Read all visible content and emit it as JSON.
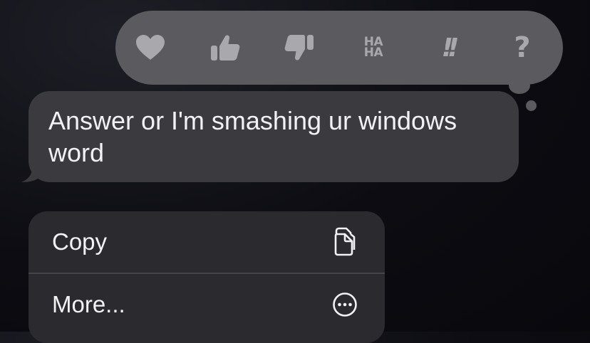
{
  "tapback": {
    "reactions": [
      {
        "name": "heart",
        "icon": "heart-icon"
      },
      {
        "name": "thumbs-up",
        "icon": "thumbs-up-icon"
      },
      {
        "name": "thumbs-down",
        "icon": "thumbs-down-icon"
      },
      {
        "name": "haha",
        "icon": "haha-icon",
        "text_top": "HA",
        "text_bottom": "HA"
      },
      {
        "name": "emphasize",
        "icon": "exclamation-icon",
        "text": "!!"
      },
      {
        "name": "question",
        "icon": "question-icon",
        "text": "?"
      }
    ]
  },
  "message": {
    "text": "Answer or I'm smashing ur windows word"
  },
  "context_menu": {
    "items": [
      {
        "label": "Copy",
        "icon": "copy-icon"
      },
      {
        "label": "More...",
        "icon": "more-icon"
      }
    ]
  },
  "colors": {
    "tapback_bg": "#5b5b5f",
    "icon": "#a9a9ad",
    "bubble_bg": "#3a3a3f",
    "menu_bg": "#2b2b2f",
    "text": "#f2f2f4"
  }
}
